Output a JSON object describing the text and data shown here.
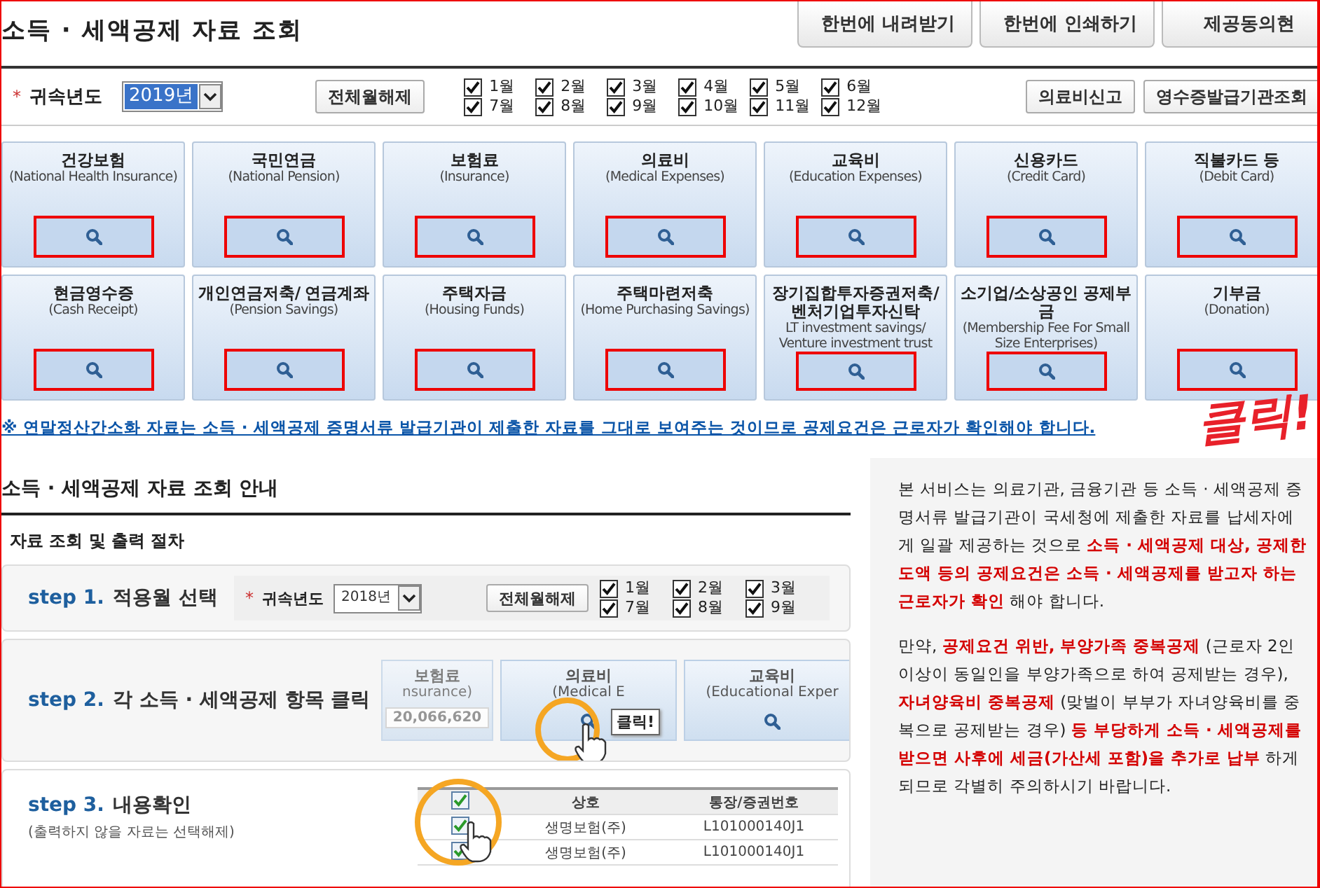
{
  "page_title": "소득 · 세액공제 자료 조회",
  "top_buttons": [
    {
      "label": "한번에 내려받기"
    },
    {
      "label": "한번에 인쇄하기"
    },
    {
      "label": "제공동의현"
    }
  ],
  "filter": {
    "required_mark": "*",
    "year_label": "귀속년도",
    "year": "2019년",
    "clear_button": "전체월해제",
    "months": [
      {
        "label": "1월",
        "checked": true
      },
      {
        "label": "2월",
        "checked": true
      },
      {
        "label": "3월",
        "checked": true
      },
      {
        "label": "4월",
        "checked": true
      },
      {
        "label": "5월",
        "checked": true
      },
      {
        "label": "6월",
        "checked": true
      },
      {
        "label": "7월",
        "checked": true
      },
      {
        "label": "8월",
        "checked": true
      },
      {
        "label": "9월",
        "checked": true
      },
      {
        "label": "10월",
        "checked": true
      },
      {
        "label": "11월",
        "checked": true
      },
      {
        "label": "12월",
        "checked": true
      }
    ],
    "side_buttons": [
      "의료비신고",
      "영수증발급기관조회"
    ]
  },
  "categories": [
    {
      "title": "건강보험",
      "subtitle": "(National Health Insurance)",
      "highlighted": true
    },
    {
      "title": "국민연금",
      "subtitle": "(National Pension)",
      "highlighted": true
    },
    {
      "title": "보험료",
      "subtitle": "(Insurance)",
      "highlighted": true
    },
    {
      "title": "의료비",
      "subtitle": "(Medical Expenses)",
      "highlighted": true
    },
    {
      "title": "교육비",
      "subtitle": "(Education Expenses)",
      "highlighted": true
    },
    {
      "title": "신용카드",
      "subtitle": "(Credit Card)",
      "highlighted": true
    },
    {
      "title": "직불카드 등",
      "subtitle": "(Debit Card)",
      "highlighted": true
    },
    {
      "title": "현금영수증",
      "subtitle": "(Cash Receipt)",
      "highlighted": true
    },
    {
      "title": "개인연금저축/ 연금계좌",
      "subtitle": "(Pension Savings)",
      "highlighted": true
    },
    {
      "title": "주택자금",
      "subtitle": "(Housing Funds)",
      "highlighted": true
    },
    {
      "title": "주택마련저축",
      "subtitle": "(Home Purchasing Savings)",
      "highlighted": true
    },
    {
      "title": "장기집합투자증권저축/ 벤처기업투자신탁",
      "subtitle": "LT investment savings/ Venture investment trust",
      "highlighted": true
    },
    {
      "title": "소기업/소상공인 공제부금",
      "subtitle": "(Membership Fee For Small Size Enterprises)",
      "highlighted": true
    },
    {
      "title": "기부금",
      "subtitle": "(Donation)",
      "highlighted": true
    }
  ],
  "notice": "※ 연말정산간소화 자료는 소득 · 세액공제 증명서류 발급기관이 제출한 자료를 그대로 보여주는 것이므로 공제요건은 근로자가 확인해야 합니다.",
  "annotation": "클릭!",
  "guide": {
    "title": "소득 · 세액공제 자료 조회 안내",
    "subtitle": "자료 조회 및 출력 절차",
    "steps": [
      {
        "kind": "months",
        "label": "step 1.",
        "title": "적용월 선택",
        "required_mark": "*",
        "year_label": "귀속년도",
        "year": "2018년",
        "clear_button": "전체월해제",
        "months": [
          {
            "label": "1월",
            "checked": true
          },
          {
            "label": "2월",
            "checked": true
          },
          {
            "label": "3월",
            "checked": true
          },
          {
            "label": "7월",
            "checked": true
          },
          {
            "label": "8월",
            "checked": true
          },
          {
            "label": "9월",
            "checked": true
          }
        ]
      },
      {
        "kind": "cards",
        "label": "step 2.",
        "title": "각 소득 · 세액공제 항목 클릭",
        "tooltip": "클릭!",
        "cards": [
          {
            "title": "보험료",
            "subtitle": "nsurance)",
            "amount": "20,066,620",
            "highlighted": false
          },
          {
            "title": "의료비",
            "subtitle": "(Medical E",
            "highlighted": true
          },
          {
            "title": "교육비",
            "subtitle": "(Educational Exper",
            "highlighted": false
          }
        ]
      },
      {
        "kind": "table",
        "label": "step 3.",
        "title": "내용확인",
        "note": "(출력하지 않을 자료는 선택해제)",
        "all_checked": true,
        "columns": [
          "상호",
          "통장/증권번호"
        ],
        "rows": [
          {
            "checked": true,
            "cells": [
              "생명보험(주)",
              "L101000140J1"
            ]
          },
          {
            "checked": true,
            "cells": [
              "생명보험(주)",
              "L101000140J1"
            ]
          }
        ]
      }
    ]
  },
  "info": [
    "본 서비스는 의료기관, 금융기관 등 소득 · 세액공제 증명서류 발급기관이 국세청에 제출한 자료를 납세자에게 일괄 제공하는 것으로 **소득 · 세액공제 대상, 공제한도액 등의 공제요건은 소득 · 세액공제를 받고자 하는 근로자가 확인** 해야 합니다.",
    "만약, **공제요건 위반, 부양가족 중복공제** (근로자 2인 이상이 동일인을 부양가족으로 하여 공제받는 경우), **자녀양육비 중복공제** (맞벌이 부부가 자녀양육비를 중복으로 공제받는 경우) **등 부당하게 소득 · 세액공제를 받으면 사후에 세금(가산세 포함)을 추가로 납부** 하게 되므로 각별히 주의하시기 바랍니다."
  ]
}
